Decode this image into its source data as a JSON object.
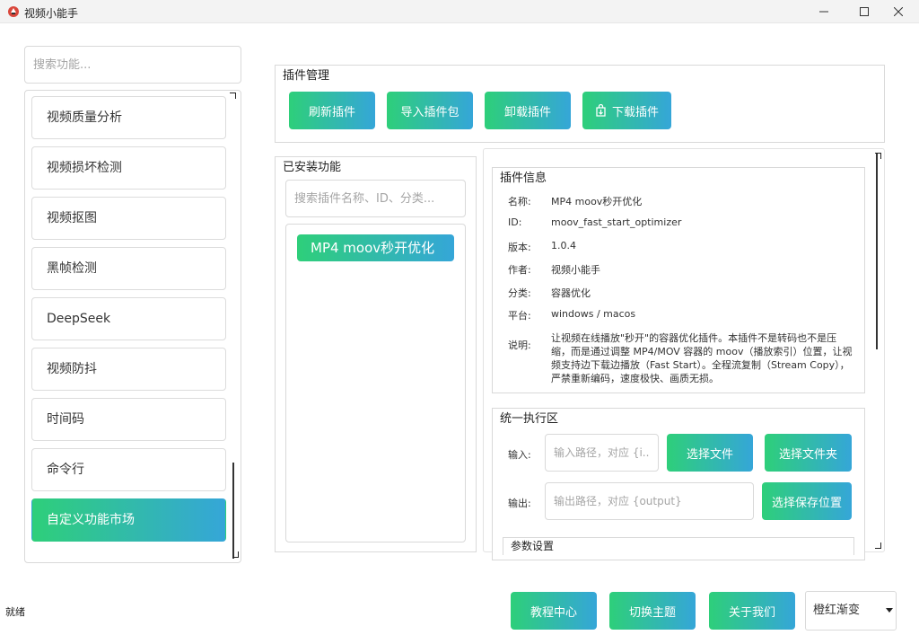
{
  "window": {
    "title": "视频小能手"
  },
  "sidebar": {
    "search_placeholder": "搜索功能...",
    "items": [
      {
        "label": "视频质量分析",
        "active": false
      },
      {
        "label": "视频损坏检测",
        "active": false
      },
      {
        "label": "视频抠图",
        "active": false
      },
      {
        "label": "黑帧检测",
        "active": false
      },
      {
        "label": "DeepSeek",
        "active": false
      },
      {
        "label": "视频防抖",
        "active": false
      },
      {
        "label": "时间码",
        "active": false
      },
      {
        "label": "命令行",
        "active": false
      },
      {
        "label": "自定义功能市场",
        "active": true
      }
    ]
  },
  "plugin_management": {
    "title": "插件管理",
    "buttons": {
      "refresh": "刷新插件",
      "import": "导入插件包",
      "uninstall": "卸载插件",
      "download": "下载插件"
    }
  },
  "installed": {
    "title": "已安装功能",
    "search_placeholder": "搜索插件名称、ID、分类...",
    "plugins": [
      "MP4 moov秒开优化"
    ]
  },
  "plugin_info": {
    "title": "插件信息",
    "name_label": "名称:",
    "name": "MP4 moov秒开优化",
    "id_label": "ID:",
    "id": "moov_fast_start_optimizer",
    "version_label": "版本:",
    "version": "1.0.4",
    "author_label": "作者:",
    "author": "视频小能手",
    "category_label": "分类:",
    "category": "容器优化",
    "platform_label": "平台:",
    "platform": "windows / macos",
    "desc_label": "说明:",
    "description": "让视频在线播放\"秒开\"的容器优化插件。本插件不是转码也不是压缩，而是通过调整 MP4/MOV 容器的 moov（播放索引）位置，让视频支持边下载边播放（Fast Start）。全程流复制（Stream Copy），严禁重新编码，速度极快、画质无损。"
  },
  "execution": {
    "title": "统一执行区",
    "input_label": "输入:",
    "input_placeholder": "输入路径，对应 {i...",
    "select_file": "选择文件",
    "select_folder": "选择文件夹",
    "output_label": "输出:",
    "output_placeholder": "输出路径，对应 {output}",
    "select_save": "选择保存位置",
    "params_title": "参数设置"
  },
  "footer": {
    "status": "就绪",
    "tutorial": "教程中心",
    "switch_theme": "切换主题",
    "about": "关于我们",
    "theme_value": "橙红渐变"
  },
  "colors": {
    "gradient_start": "#2ecf7a",
    "gradient_end": "#35a6d8"
  }
}
